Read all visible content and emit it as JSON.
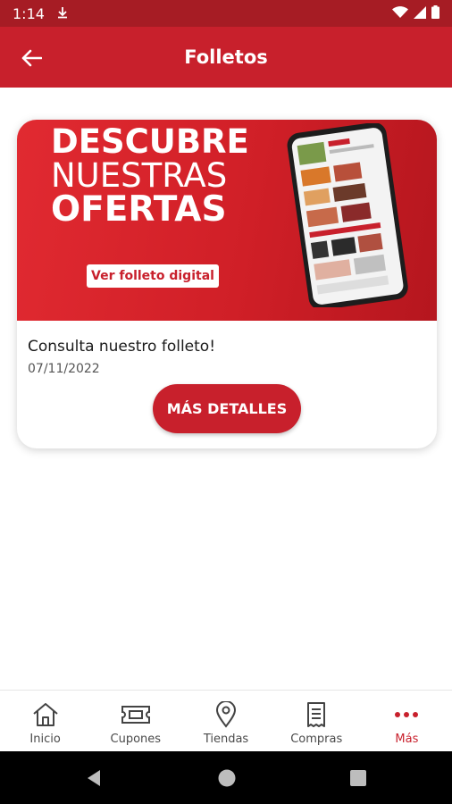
{
  "status_bar": {
    "time": "1:14"
  },
  "app_bar": {
    "title": "Folletos"
  },
  "banner": {
    "line1": "DESCUBRE",
    "line2": "NUESTRAS",
    "line3": "OFERTAS",
    "cta_label": "Ver folleto digital"
  },
  "card": {
    "caption": "Consulta nuestro folleto!",
    "date": "07/11/2022",
    "details_label": "MÁS DETALLES"
  },
  "bottom_nav": {
    "items": [
      {
        "label": "Inicio",
        "icon": "home-icon"
      },
      {
        "label": "Cupones",
        "icon": "ticket-icon"
      },
      {
        "label": "Tiendas",
        "icon": "location-pin-icon"
      },
      {
        "label": "Compras",
        "icon": "receipt-icon"
      },
      {
        "label": "Más",
        "icon": "more-dots-icon"
      }
    ],
    "active_index": 4
  },
  "colors": {
    "brand": "#c8202c",
    "status_bar": "#a61c24"
  }
}
